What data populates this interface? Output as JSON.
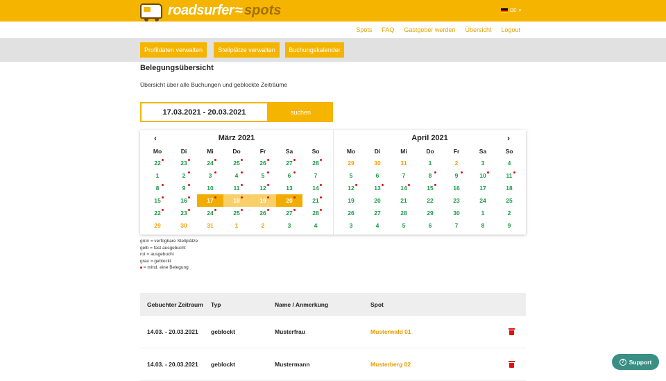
{
  "header": {
    "logo_text": "roadsurfer",
    "logo_wave": "≈",
    "logo_spots": "spots",
    "language": "DE",
    "language_caret": "▾"
  },
  "subnav": [
    "Spots",
    "FAQ",
    "Gastgeber werden",
    "Übersicht",
    "Logout"
  ],
  "actions": [
    "Profildaten verwalten",
    "Stellplätze verwalten",
    "Buchungskalender"
  ],
  "page": {
    "title": "Belegungsübersicht",
    "description": "Übersicht über alle Buchungen und geblockte Zeiträume"
  },
  "search": {
    "date_range": "17.03.2021 - 20.03.2021",
    "button": "suchen"
  },
  "calendar": {
    "prev_arrow": "‹",
    "next_arrow": "›",
    "weekdays": [
      "Mo",
      "Di",
      "Mi",
      "Do",
      "Fr",
      "Sa",
      "So"
    ],
    "months": [
      {
        "title": "März 2021",
        "days": [
          {
            "d": "22",
            "c": "green",
            "dot": true
          },
          {
            "d": "23",
            "c": "green",
            "dot": true
          },
          {
            "d": "24",
            "c": "green",
            "dot": true
          },
          {
            "d": "25",
            "c": "green",
            "dot": true
          },
          {
            "d": "26",
            "c": "green",
            "dot": true
          },
          {
            "d": "27",
            "c": "green",
            "dot": true
          },
          {
            "d": "28",
            "c": "green",
            "dot": true
          },
          {
            "d": "1",
            "c": "green"
          },
          {
            "d": "2",
            "c": "green",
            "dot": true
          },
          {
            "d": "3",
            "c": "green",
            "dot": true
          },
          {
            "d": "4",
            "c": "green",
            "dot": true
          },
          {
            "d": "5",
            "c": "green",
            "dot": true
          },
          {
            "d": "6",
            "c": "green",
            "dot": true
          },
          {
            "d": "7",
            "c": "green"
          },
          {
            "d": "8",
            "c": "green",
            "dot": true
          },
          {
            "d": "9",
            "c": "green",
            "dot": true
          },
          {
            "d": "10",
            "c": "green"
          },
          {
            "d": "11",
            "c": "green",
            "dot": true
          },
          {
            "d": "12",
            "c": "green",
            "dot": true
          },
          {
            "d": "13",
            "c": "green"
          },
          {
            "d": "14",
            "c": "green",
            "dot": true
          },
          {
            "d": "15",
            "c": "green",
            "dot": true
          },
          {
            "d": "16",
            "c": "green",
            "dot": true
          },
          {
            "d": "17",
            "c": "white",
            "dot": true,
            "sel": "edge"
          },
          {
            "d": "18",
            "c": "white",
            "dot": true,
            "sel": "mid"
          },
          {
            "d": "19",
            "c": "white",
            "dot": true,
            "sel": "mid"
          },
          {
            "d": "20",
            "c": "white",
            "dot": true,
            "sel": "edge"
          },
          {
            "d": "21",
            "c": "green",
            "dot": true
          },
          {
            "d": "22",
            "c": "green",
            "dot": true
          },
          {
            "d": "23",
            "c": "green",
            "dot": true
          },
          {
            "d": "24",
            "c": "green",
            "dot": true
          },
          {
            "d": "25",
            "c": "green",
            "dot": true
          },
          {
            "d": "26",
            "c": "green",
            "dot": true
          },
          {
            "d": "27",
            "c": "green",
            "dot": true
          },
          {
            "d": "28",
            "c": "green",
            "dot": true
          },
          {
            "d": "29",
            "c": "orange"
          },
          {
            "d": "30",
            "c": "orange"
          },
          {
            "d": "31",
            "c": "orange"
          },
          {
            "d": "1",
            "c": "orange"
          },
          {
            "d": "2",
            "c": "orange"
          },
          {
            "d": "3",
            "c": "green"
          },
          {
            "d": "4",
            "c": "green"
          }
        ]
      },
      {
        "title": "April 2021",
        "days": [
          {
            "d": "29",
            "c": "orange"
          },
          {
            "d": "30",
            "c": "orange"
          },
          {
            "d": "31",
            "c": "orange"
          },
          {
            "d": "1",
            "c": "green"
          },
          {
            "d": "2",
            "c": "orange"
          },
          {
            "d": "3",
            "c": "green"
          },
          {
            "d": "4",
            "c": "green"
          },
          {
            "d": "5",
            "c": "green"
          },
          {
            "d": "6",
            "c": "green"
          },
          {
            "d": "7",
            "c": "green"
          },
          {
            "d": "8",
            "c": "green",
            "dot": true
          },
          {
            "d": "9",
            "c": "green",
            "dot": true
          },
          {
            "d": "10",
            "c": "green",
            "dot": true
          },
          {
            "d": "11",
            "c": "green",
            "dot": true
          },
          {
            "d": "12",
            "c": "green",
            "dot": true
          },
          {
            "d": "13",
            "c": "green",
            "dot": true
          },
          {
            "d": "14",
            "c": "green",
            "dot": true
          },
          {
            "d": "15",
            "c": "green",
            "dot": true
          },
          {
            "d": "16",
            "c": "green"
          },
          {
            "d": "17",
            "c": "green"
          },
          {
            "d": "18",
            "c": "green"
          },
          {
            "d": "19",
            "c": "green"
          },
          {
            "d": "20",
            "c": "green"
          },
          {
            "d": "21",
            "c": "green"
          },
          {
            "d": "22",
            "c": "green"
          },
          {
            "d": "23",
            "c": "green"
          },
          {
            "d": "24",
            "c": "green"
          },
          {
            "d": "25",
            "c": "green"
          },
          {
            "d": "26",
            "c": "green"
          },
          {
            "d": "27",
            "c": "green"
          },
          {
            "d": "28",
            "c": "green"
          },
          {
            "d": "29",
            "c": "green"
          },
          {
            "d": "30",
            "c": "green"
          },
          {
            "d": "1",
            "c": "green"
          },
          {
            "d": "2",
            "c": "green"
          },
          {
            "d": "3",
            "c": "green"
          },
          {
            "d": "4",
            "c": "green"
          },
          {
            "d": "5",
            "c": "green"
          },
          {
            "d": "6",
            "c": "green"
          },
          {
            "d": "7",
            "c": "green"
          },
          {
            "d": "8",
            "c": "green"
          },
          {
            "d": "9",
            "c": "green"
          }
        ]
      }
    ]
  },
  "legend": {
    "green": "grün = verfügbare Stellplätze",
    "yellow": "gelb = fast ausgebucht",
    "red": "rot = ausgebucht",
    "grey": "grau = geblockt",
    "dot": "= mind. eine Belegung"
  },
  "table": {
    "headers": [
      "Gebuchter Zeitraum",
      "Typ",
      "Name / Anmerkung",
      "Spot"
    ],
    "rows": [
      {
        "period": "14.03. - 20.03.2021",
        "type": "geblockt",
        "name": "Musterfrau",
        "spot": "Musterwald 01"
      },
      {
        "period": "14.03. - 20.03.2021",
        "type": "geblockt",
        "name": "Mustermann",
        "spot": "Musterberg 02"
      }
    ]
  },
  "support": {
    "label": "Support",
    "icon_glyph": "?"
  },
  "colors": {
    "brand": "#f5b400",
    "available": "#179a46",
    "almost_booked": "#f0a000",
    "occupied_dot": "#dd1111",
    "support": "#3a8f84"
  }
}
